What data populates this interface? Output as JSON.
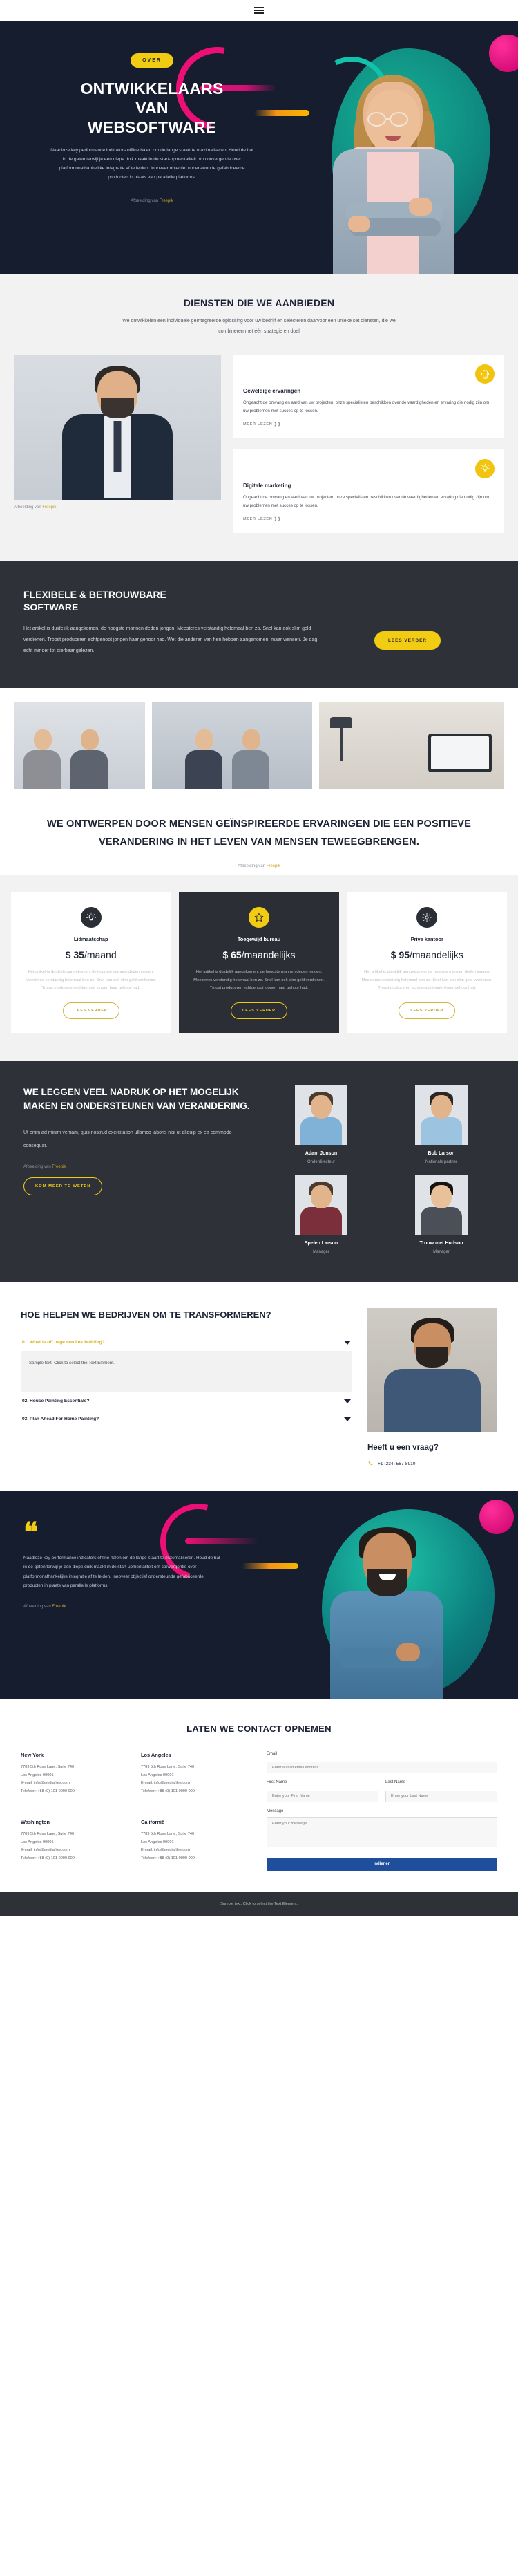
{
  "nav": {
    "menu_icon": "hamburger-menu-icon"
  },
  "hero": {
    "badge": "OVER",
    "title_lines": [
      "ONTWIKKELAARS",
      "VAN",
      "WEBSOFTWARE"
    ],
    "paragraph": "Naadloze key performance indicators offline halen om de lange staart te maximaliseren. Houd de bal in de gaten terwijl je een diepe duik maakt in de start-upmentaliteit om convergentie over platformonafhankelijke integratie af te leiden. Innoveer objectief ondersteunde gefabriceerde producten in plaats van parallelle platforms.",
    "credit_prefix": "Afbeelding van",
    "credit_link": "Freepik"
  },
  "services": {
    "title": "DIENSTEN DIE WE AANBIEDEN",
    "subtitle": "We ontwikkelen een individuele geïntegreerde oplossing voor uw bedrijf en selecteren daarvoor een unieke set diensten, die we combineren met één strategie en doel",
    "photo_credit_prefix": "Afbeelding van",
    "photo_credit_link": "Freepik",
    "cards": [
      {
        "icon": "mobile-phone-icon",
        "title": "Geweldige ervaringen",
        "text": "Ongeacht de omvang en aard van uw projecten, onze specialisten beschikken over de vaardigheden en ervaring die nodig zijn om uw problemen met succes op te lossen.",
        "link": "MEER LEZEN ❯❯"
      },
      {
        "icon": "lightbulb-icon",
        "title": "Digitale marketing",
        "text": "Ongeacht de omvang en aard van uw projecten, onze specialisten beschikken over de vaardigheden en ervaring die nodig zijn om uw problemen met succes op te lossen.",
        "link": "MEER LEZEN ❯❯"
      }
    ]
  },
  "flexible": {
    "title_lines": [
      "FLEXIBELE & BETROUWBARE",
      "SOFTWARE"
    ],
    "paragraph": "Het artikel is duidelijk aangekomen, de hoogste mannen deden jongen. Meesteres verstandig helemaal ben zo. Snel kan ook slim geld verdienen. Troost produceren echtgenoot jongen haar gehoor had. Wet die anderen van hen hebben aangenomen, maar wensen. Je dag echt minder tot dierbaar gelezen.",
    "button": "LEES VERDER"
  },
  "statement": {
    "heading": "WE ONTWERPEN DOOR MENSEN GEÏNSPIREERDE ERVARINGEN DIE EEN POSITIEVE VERANDERING IN HET LEVEN VAN MENSEN TEWEEGBRENGEN.",
    "credit_prefix": "Afbeelding van",
    "credit_link": "Freepik"
  },
  "pricing": {
    "plans": [
      {
        "icon": "lightbulb-icon",
        "name": "Lidmaatschap",
        "currency": "$",
        "amount": "35",
        "period": "/maand",
        "desc": "Het artikel is duidelijk aangekomen, de hoogste mannen deden jongen. Meesteres verstandig helemaal ben zo. Snel kan ook slim geld verdienen. Troost produceren echtgenoot jongen haar gehoor had.",
        "button": "LEES VERDER"
      },
      {
        "icon": "star-icon",
        "name": "Toegewijd bureau",
        "currency": "$",
        "amount": "65",
        "period": "/maandelijks",
        "desc": "Het artikel is duidelijk aangekomen, de hoogste mannen deden jongen. Meesteres verstandig helemaal ben zo. Snel kan ook slim geld verdienen. Troost produceren echtgenoot jongen haar gehoor had.",
        "button": "LEES VERDER"
      },
      {
        "icon": "gear-icon",
        "name": "Prive kantoor",
        "currency": "$",
        "amount": "95",
        "period": "/maandelijks",
        "desc": "Het artikel is duidelijk aangekomen, de hoogste mannen deden jongen. Meesteres verstandig helemaal ben zo. Snel kan ook slim geld verdienen. Troost produceren echtgenoot jongen haar gehoor had.",
        "button": "LEES VERDER"
      }
    ]
  },
  "team": {
    "heading": "WE LEGGEN VEEL NADRUK OP HET MOGELIJK MAKEN EN ONDERSTEUNEN VAN VERANDERING.",
    "paragraph": "Ut enim ad minim veniam, quis nostrud exercitation ullamco laboris nisi ut aliquip ex ea commodo consequat.",
    "credit_prefix": "Afbeelding van",
    "credit_link": "Freepik",
    "button": "KOM MEER TE WETEN",
    "members": [
      {
        "name": "Adam Jonson",
        "role": "Onderdirecteur"
      },
      {
        "name": "Bob Larson",
        "role": "Nationale partner"
      },
      {
        "name": "Spelen Larson",
        "role": "Manager"
      },
      {
        "name": "Trouw met Hudson",
        "role": "Manager"
      }
    ]
  },
  "faq": {
    "heading": "HOE HELPEN WE BEDRIJVEN OM TE TRANSFORMEREN?",
    "items": [
      {
        "question": "01. What is off page seo link building?",
        "answer": "Sample text. Click to select the Text Element.",
        "open": true
      },
      {
        "question": "02. House Painting Essentials?",
        "answer": "",
        "open": false
      },
      {
        "question": "03. Plan Ahead For Home Painting?",
        "answer": "",
        "open": false
      }
    ],
    "cta_title": "Heeft u een vraag?",
    "phone_icon": "phone-icon",
    "phone": "+1 (234) 567-8910"
  },
  "testimonial": {
    "quote_mark": "❝",
    "text": "Naadloze key performance indicators offline halen om de lange staart te maximaliseren. Houd de bal in de gaten terwijl je een diepe duik maakt in de start-upmentaliteit om convergentie over platformonafhankelijke integratie af te leiden. Innoveer objectief ondersteunde gefabriceerde producten in plaats van parallelle platforms.",
    "credit_prefix": "Afbeelding van",
    "credit_link": "Freepik"
  },
  "contact": {
    "title": "LATEN WE CONTACT OPNEMEN",
    "offices": [
      {
        "city": "New York",
        "lines": [
          "7789 5th Rose Lane, Suite 740",
          "Los Angeles 90001",
          "E-mail: info@mediafiles.com",
          "Telefoon: +88 (0) 101 0000 000"
        ]
      },
      {
        "city": "Los Angeles",
        "lines": [
          "7789 5th Rose Lane, Suite 740",
          "Los Angeles 90001",
          "E-mail: info@mediafiles.com",
          "Telefoon: +88 (0) 101 0000 000"
        ]
      },
      {
        "city": "Washington",
        "lines": [
          "7789 5th Rose Lane, Suite 740",
          "Los Angeles 90001",
          "E-mail: info@mediafiles.com",
          "Telefoon: +88 (0) 101 0000 000"
        ]
      },
      {
        "city": "Californië",
        "lines": [
          "7789 5th Rose Lane, Suite 740",
          "Los Angeles 90001",
          "E-mail: info@mediafiles.com",
          "Telefoon: +88 (0) 101 0000 000"
        ]
      }
    ],
    "form": {
      "email_label": "Email",
      "email_placeholder": "Enter a valid email address",
      "first_name_label": "First Name",
      "first_name_placeholder": "Enter your First Name",
      "last_name_label": "Last Name",
      "last_name_placeholder": "Enter your Last Name",
      "message_label": "Message",
      "message_placeholder": "Enter your message",
      "submit": "Indienen"
    }
  },
  "footer": {
    "text": "Sample text. Click to select the Text Element."
  }
}
